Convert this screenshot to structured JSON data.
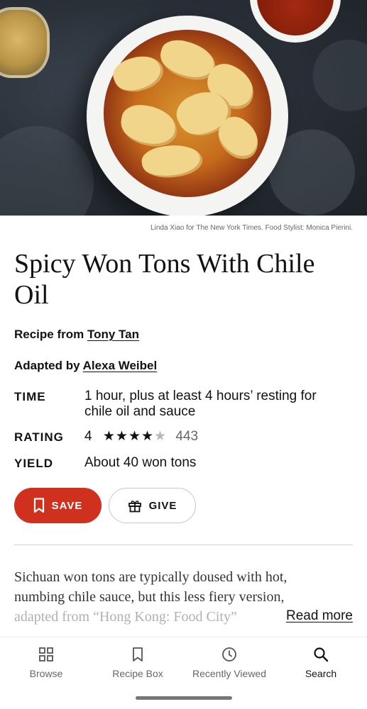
{
  "photo_credit": "Linda Xiao for The New York Times. Food Stylist: Monica Pierini.",
  "recipe": {
    "title": "Spicy Won Tons With Chile Oil",
    "recipe_from_label": "Recipe from",
    "recipe_from_name": "Tony Tan",
    "adapted_by_label": "Adapted by",
    "adapted_by_name": "Alexa Weibel",
    "time_label": "TIME",
    "time_value": "1 hour, plus at least 4 hours’ resting for chile oil and sauce",
    "rating_label": "RATING",
    "rating_value": "4",
    "rating_stars_filled": 4,
    "rating_stars_total": 5,
    "rating_count": "443",
    "yield_label": "YIELD",
    "yield_value": "About 40 won tons"
  },
  "actions": {
    "save_label": "SAVE",
    "give_label": "GIVE"
  },
  "description": {
    "line1": "Sichuan won tons are typically doused with hot,",
    "line2": "numbing chile sauce, but this less fiery version,",
    "line3": "adapted from “Hong Kong: Food City”",
    "read_more": "Read more"
  },
  "tabbar": {
    "items": [
      {
        "label": "Browse",
        "icon": "grid-icon"
      },
      {
        "label": "Recipe Box",
        "icon": "bookmark-icon"
      },
      {
        "label": "Recently Viewed",
        "icon": "clock-icon"
      },
      {
        "label": "Search",
        "icon": "search-icon"
      }
    ],
    "active": "Search"
  },
  "colors": {
    "accent": "#d0311f",
    "text": "#121212"
  }
}
